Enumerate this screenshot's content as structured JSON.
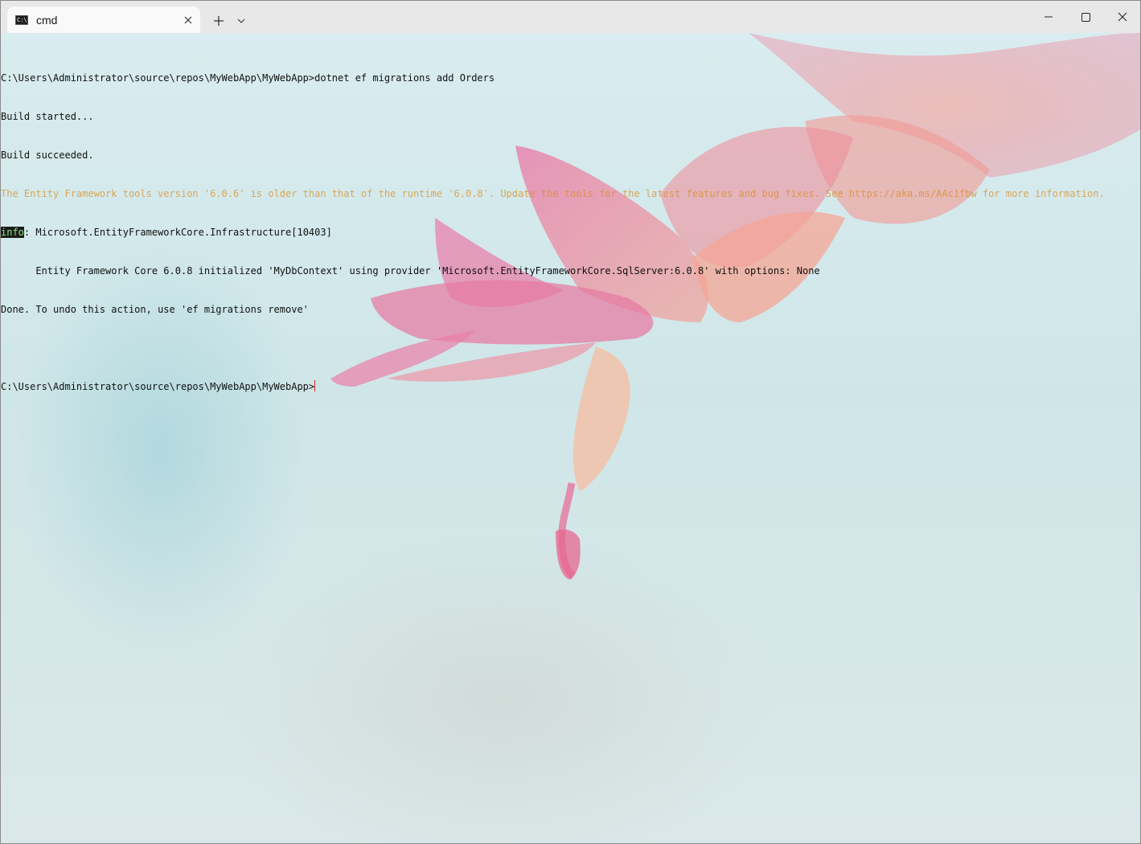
{
  "window": {
    "tab_title": "cmd",
    "tab_icon_text": "C:\\"
  },
  "colors": {
    "warning_text": "#d98a1c",
    "info_tag_bg": "#1c1c1c",
    "info_tag_fg": "#8fe37a",
    "cursor": "#d01c1c"
  },
  "terminal": {
    "lines": {
      "cmd1": "C:\\Users\\Administrator\\source\\repos\\MyWebApp\\MyWebApp>dotnet ef migrations add Orders",
      "build_started": "Build started...",
      "build_succeeded": "Build succeeded.",
      "warning": "The Entity Framework tools version '6.0.6' is older than that of the runtime '6.0.8'. Update the tools for the latest features and bug fixes. See https://aka.ms/AAc1fbw for more information.",
      "info_tag": "info",
      "info_rest": ": Microsoft.EntityFrameworkCore.Infrastructure[10403]",
      "ef_init": "      Entity Framework Core 6.0.8 initialized 'MyDbContext' using provider 'Microsoft.EntityFrameworkCore.SqlServer:6.0.8' with options: None",
      "done": "Done. To undo this action, use 'ef migrations remove'",
      "prompt": "C:\\Users\\Administrator\\source\\repos\\MyWebApp\\MyWebApp>"
    }
  }
}
